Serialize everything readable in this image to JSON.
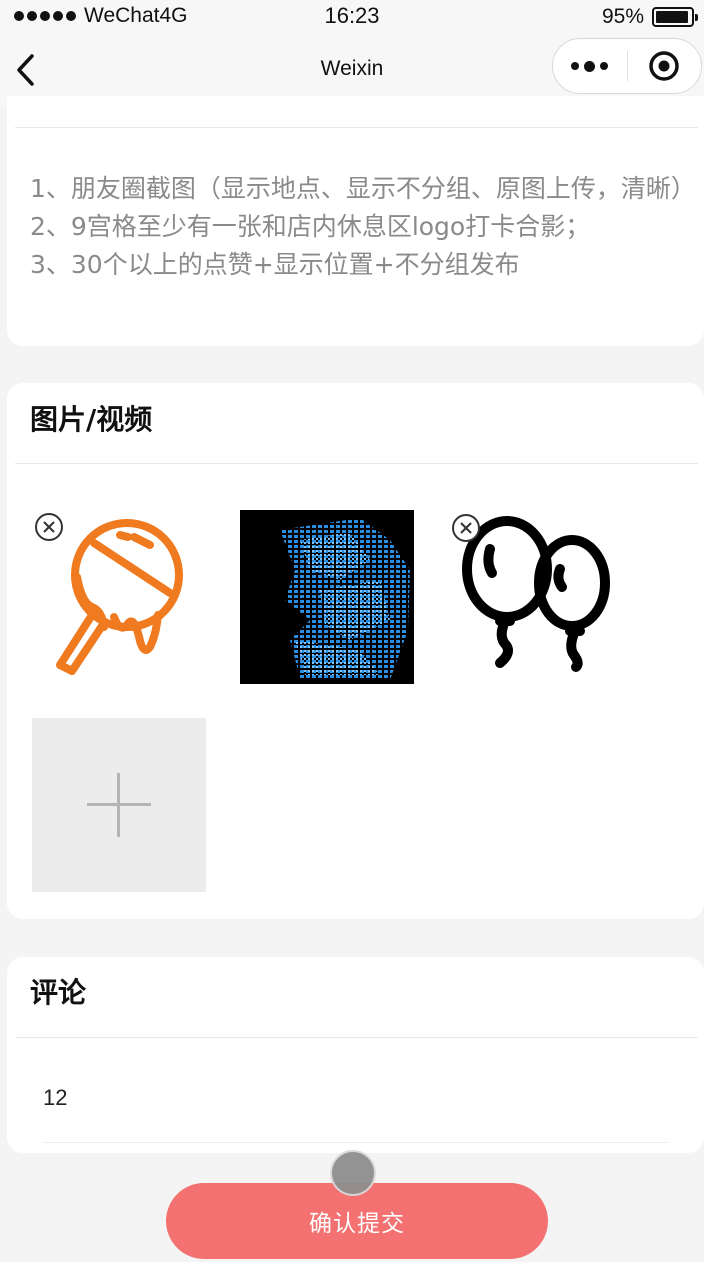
{
  "status_bar": {
    "carrier": "WeChat4G",
    "time": "16:23",
    "battery": "95%",
    "battery_level": 0.95
  },
  "nav": {
    "title": "Weixin"
  },
  "requirements": {
    "lines": [
      "1、朋友圈截图（显示地点、显示不分组、原图上传，清晰）",
      "2、9宫格至少有一张和店内休息区logo打卡合影；",
      "3、30个以上的点赞+显示位置+不分组发布"
    ]
  },
  "media": {
    "title": "图片/视频",
    "items": [
      {
        "icon": "lollipop-icon",
        "removable": true,
        "color": "#ef7a1f"
      },
      {
        "icon": "glitch-image",
        "removable": false,
        "color": "#1e90d8"
      },
      {
        "icon": "balloons-icon",
        "removable": true,
        "color": "#000000"
      }
    ]
  },
  "comment": {
    "title": "评论",
    "value": "12"
  },
  "submit": {
    "label": "确认提交",
    "color": "#f37170"
  }
}
